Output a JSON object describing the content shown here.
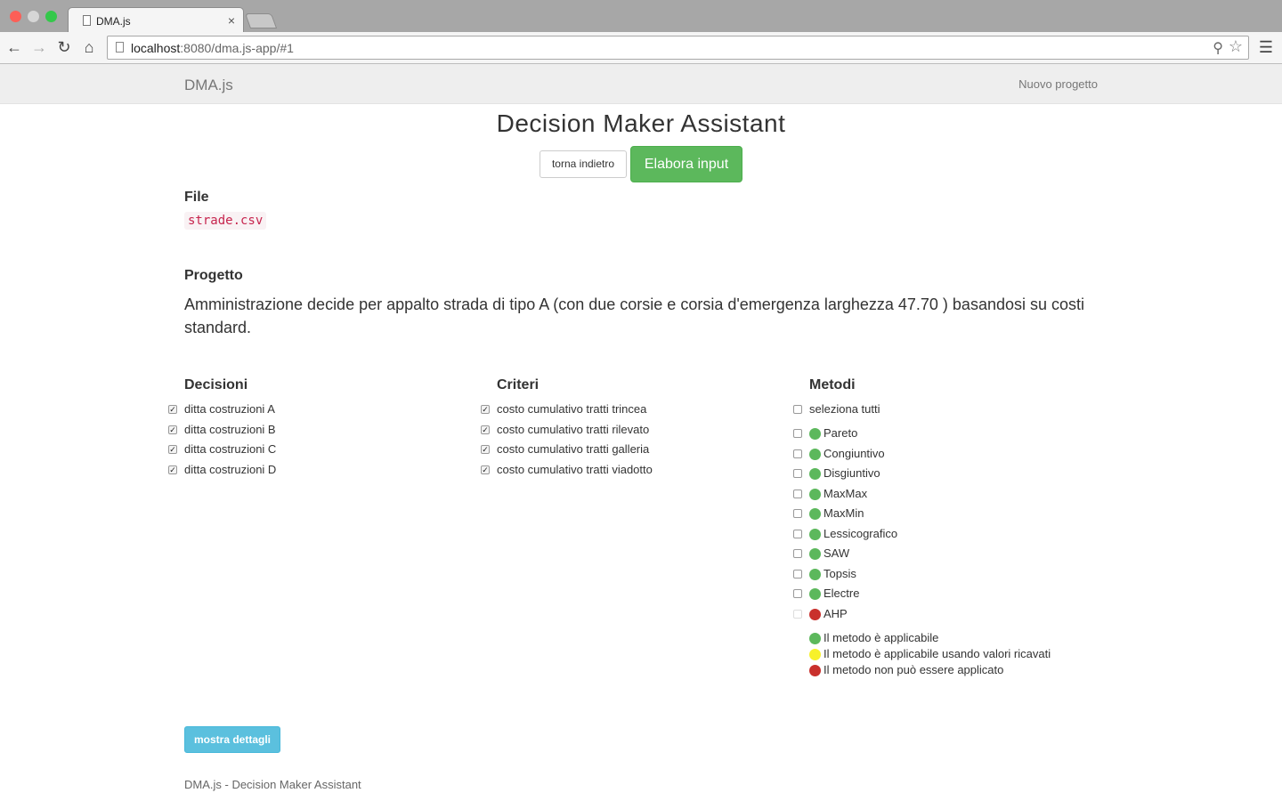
{
  "browser": {
    "tab_title": "DMA.js",
    "tab_close": "×",
    "url_host": "localhost",
    "url_path": ":8080/dma.js-app/#1",
    "icons": [
      "back-arrow-icon",
      "forward-arrow-icon",
      "reload-icon",
      "home-icon",
      "zoom-icon",
      "star-icon",
      "menu-icon"
    ]
  },
  "navbar": {
    "brand": "DMA.js",
    "new_project": "Nuovo progetto"
  },
  "page": {
    "title": "Decision Maker Assistant",
    "back_button": "torna indietro",
    "process_button": "Elabora input"
  },
  "file": {
    "heading": "File",
    "name": "strade.csv"
  },
  "project": {
    "heading": "Progetto",
    "description": "Amministrazione decide per appalto strada di tipo A (con due corsie e corsia d'emergenza larghezza 47.70 ) basandosi su costi standard."
  },
  "decisions": {
    "heading": "Decisioni",
    "items": [
      {
        "label": "ditta costruzioni A",
        "checked": true
      },
      {
        "label": "ditta costruzioni B",
        "checked": true
      },
      {
        "label": "ditta costruzioni C",
        "checked": true
      },
      {
        "label": "ditta costruzioni D",
        "checked": true
      }
    ]
  },
  "criteria": {
    "heading": "Criteri",
    "items": [
      {
        "label": "costo cumulativo tratti trincea",
        "checked": true
      },
      {
        "label": "costo cumulativo tratti rilevato",
        "checked": true
      },
      {
        "label": "costo cumulativo tratti galleria",
        "checked": true
      },
      {
        "label": "costo cumulativo tratti viadotto",
        "checked": true
      }
    ]
  },
  "methods": {
    "heading": "Metodi",
    "select_all": "seleziona tutti",
    "items": [
      {
        "label": "Pareto",
        "status": "green"
      },
      {
        "label": "Congiuntivo",
        "status": "green"
      },
      {
        "label": "Disgiuntivo",
        "status": "green"
      },
      {
        "label": "MaxMax",
        "status": "green"
      },
      {
        "label": "MaxMin",
        "status": "green"
      },
      {
        "label": "Lessicografico",
        "status": "green"
      },
      {
        "label": "SAW",
        "status": "green"
      },
      {
        "label": "Topsis",
        "status": "green"
      },
      {
        "label": "Electre",
        "status": "green"
      },
      {
        "label": "AHP",
        "status": "red"
      }
    ]
  },
  "legend": {
    "items": [
      {
        "label": "Il metodo è applicabile",
        "status": "green"
      },
      {
        "label": "Il metodo è applicabile usando valori ricavati",
        "status": "yellow"
      },
      {
        "label": "Il metodo non può essere applicato",
        "status": "red"
      }
    ]
  },
  "colors": {
    "green": "#5cb85c",
    "yellow": "#f7f12a",
    "red": "#c9302c"
  },
  "details_button": "mostra dettagli",
  "footer": "DMA.js - Decision Maker Assistant"
}
